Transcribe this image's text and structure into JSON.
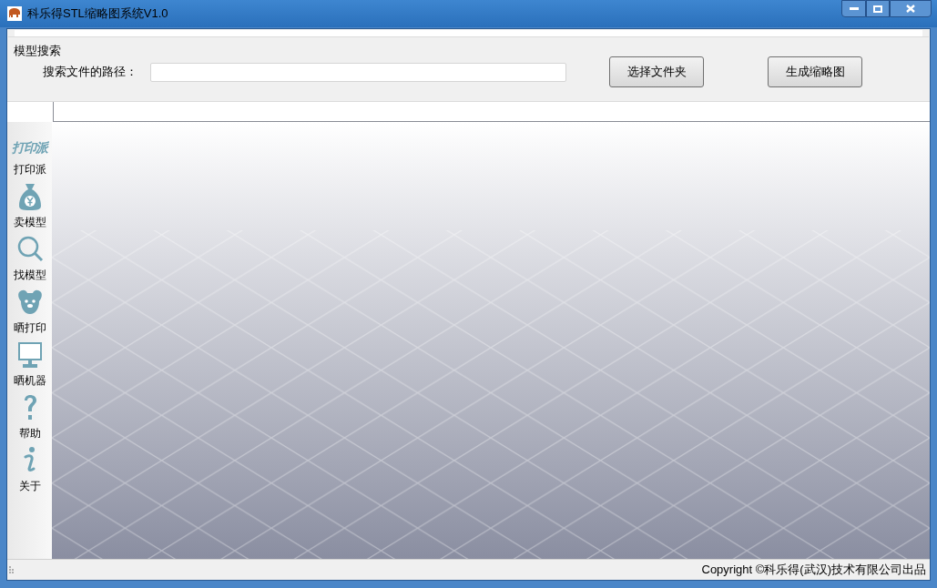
{
  "window": {
    "title": "科乐得STL缩略图系统V1.0"
  },
  "search_group": {
    "title": "模型搜索",
    "path_label": "搜索文件的路径：",
    "buttons": [
      "选择文件夹",
      "生成缩略图"
    ]
  },
  "tabs": [
    {
      "selected": true
    }
  ],
  "sidebar": {
    "items": [
      {
        "kind": "logo",
        "logo_text": "打印派",
        "label": "打印派"
      },
      {
        "kind": "icon",
        "label": "卖模型"
      },
      {
        "kind": "icon",
        "label": "找模型"
      },
      {
        "kind": "icon",
        "label": "晒打印"
      },
      {
        "kind": "icon",
        "label": "晒机器"
      },
      {
        "kind": "icon",
        "label": "帮助"
      },
      {
        "kind": "icon",
        "label": "关于"
      }
    ]
  },
  "status_bar": {
    "text": "Copyright ©科乐得(武汉)技术有限公司出品"
  }
}
